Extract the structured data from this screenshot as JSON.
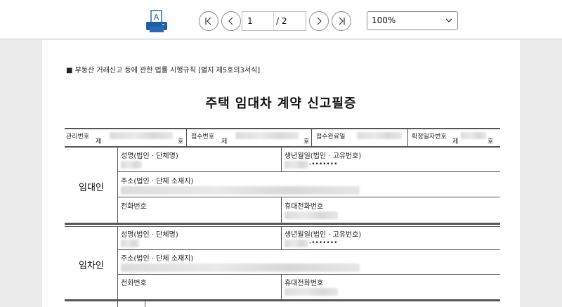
{
  "toolbar": {
    "current_page": "1",
    "total_pages": "/ 2",
    "zoom": "100%"
  },
  "document": {
    "regulation": "■ 부동산 거래신고 등에 관한 법률 시행규칙 [별지 제5호의3서식]",
    "title": "주택 임대차 계약 신고필증",
    "header_row": {
      "mgmt_no": "관리번호",
      "receipt_no": "접수번호",
      "receipt_done": "접수완료일",
      "confirm_date": "확정일자번호",
      "je": "제",
      "ho": "호"
    },
    "lessor": {
      "section": "임대인",
      "name_label": "성명(법인 · 단체명)",
      "birth_label": "생년월일(법인 · 고유번호)",
      "birth_mask": "-•••••••",
      "address_label": "주소(법인 · 단체 소재지)",
      "phone_label": "전화번호",
      "mobile_label": "휴대전화번호"
    },
    "lessee": {
      "section": "임차인",
      "name_label": "성명(법인 · 단체명)",
      "birth_label": "생년월일(법인 · 고유번호)",
      "birth_mask": "-•••••••",
      "address_label": "주소(법인 · 단체 소재지)",
      "phone_label": "전화번호",
      "mobile_label": "휴대전화번호"
    }
  },
  "colors": {
    "toolbar_bg": "#ffffff",
    "viewer_bg": "#ececec",
    "printer_blue": "#1f5fa8"
  },
  "icons": [
    "printer-icon",
    "first-page-icon",
    "prev-page-icon",
    "next-page-icon",
    "last-page-icon",
    "chevron-down-icon"
  ]
}
